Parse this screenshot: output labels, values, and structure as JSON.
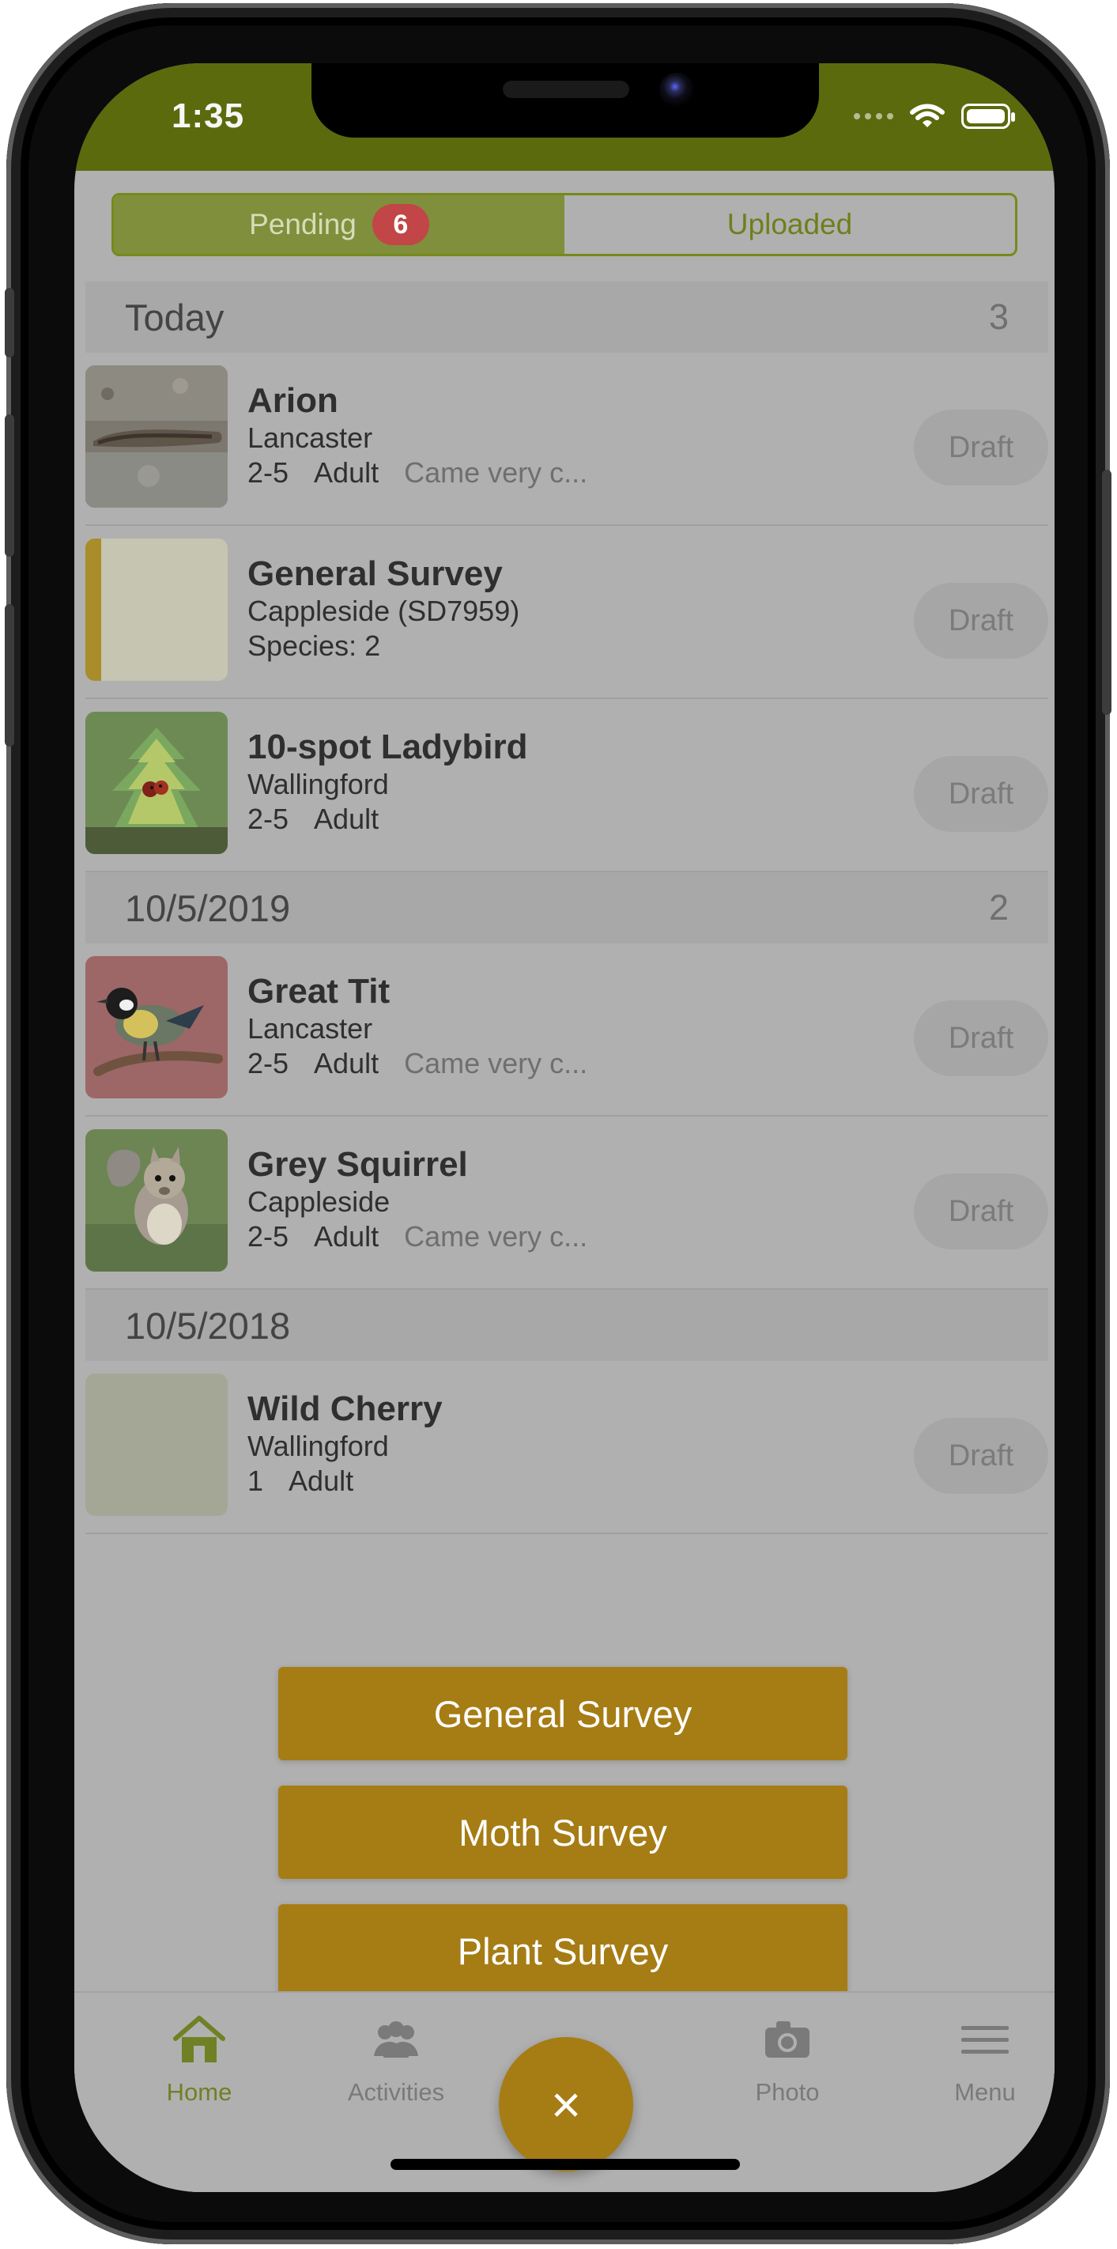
{
  "statusBar": {
    "time": "1:35",
    "icons": [
      "signal-icon",
      "wifi-icon",
      "battery-icon"
    ]
  },
  "segmented": {
    "pending_label": "Pending",
    "pending_count": "6",
    "uploaded_label": "Uploaded"
  },
  "sections": [
    {
      "date": "Today",
      "count": "3",
      "records": [
        {
          "title": "Arion",
          "location": "Lancaster",
          "number": "2-5",
          "stage": "Adult",
          "note": "Came very c...",
          "status": "Draft",
          "thumbnail": "slug-photo"
        },
        {
          "title": "General Survey",
          "location": "Cappleside (SD7959)",
          "meta": "Species: 2",
          "status": "Draft",
          "thumbnail": "survey-card"
        },
        {
          "title": "10-spot Ladybird",
          "location": "Wallingford",
          "number": "2-5",
          "stage": "Adult",
          "status": "Draft",
          "thumbnail": "ladybird-photo"
        }
      ]
    },
    {
      "date": "10/5/2019",
      "count": "2",
      "records": [
        {
          "title": "Great Tit",
          "location": "Lancaster",
          "number": "2-5",
          "stage": "Adult",
          "note": "Came very c...",
          "status": "Draft",
          "thumbnail": "bird-photo"
        },
        {
          "title": "Grey Squirrel",
          "location": "Cappleside",
          "number": "2-5",
          "stage": "Adult",
          "note": "Came very c...",
          "status": "Draft",
          "thumbnail": "squirrel-photo"
        }
      ]
    },
    {
      "date": "10/5/2018",
      "records": [
        {
          "title": "Wild Cherry",
          "location": "Wallingford",
          "number": "1",
          "stage": "Adult",
          "status": "Draft",
          "thumbnail": "blank-card"
        }
      ]
    }
  ],
  "actions": {
    "general_survey": "General Survey",
    "moth_survey": "Moth Survey",
    "plant_survey": "Plant Survey",
    "close_icon": "×"
  },
  "tabs": {
    "home": "Home",
    "activities": "Activities",
    "photo": "Photo",
    "menu": "Menu"
  },
  "colors": {
    "header_green": "#5b6a0d",
    "accent_green": "#6f8124",
    "accent_gold": "#a67c14",
    "badge_red": "#c24547"
  }
}
